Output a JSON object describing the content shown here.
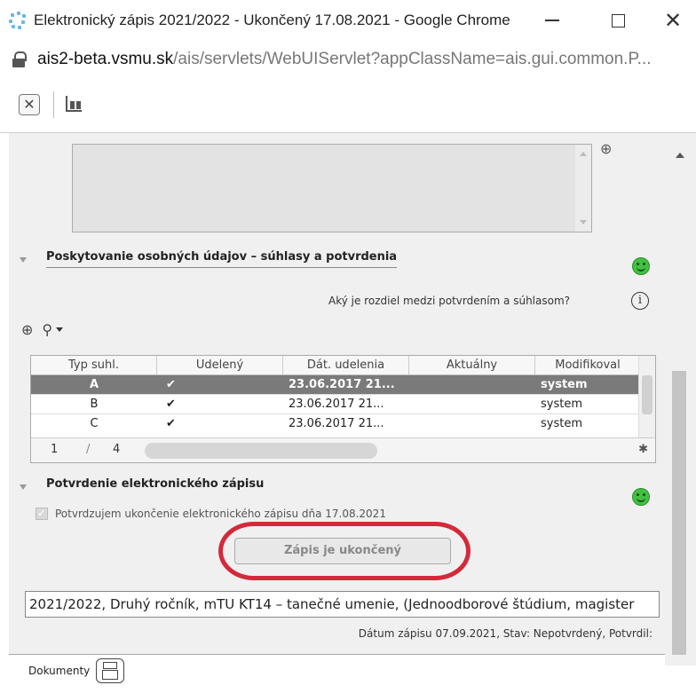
{
  "window": {
    "title": "Elektronický zápis 2021/2022 - Ukončený 17.08.2021 - Google Chrome"
  },
  "address_bar": {
    "host": "ais2-beta.vsmu.sk",
    "path": "/ais/servlets/WebUIServlet?appClassName=ais.gui.common.P..."
  },
  "consent_section": {
    "title": "Poskytovanie osobných údajov – súhlasy a potvrdenia",
    "question_link": "Aký je rozdiel medzi potvrdením a súhlasom?",
    "table": {
      "columns": [
        "Typ suhl.",
        "Udelený",
        "Dát. udelenia",
        "Aktuálny",
        "Modifikoval"
      ],
      "rows": [
        {
          "type": "A",
          "granted": "✔",
          "date": "23.06.2017 21...",
          "current": "",
          "modified_by": "system"
        },
        {
          "type": "B",
          "granted": "✔",
          "date": "23.06.2017 21...",
          "current": "",
          "modified_by": "system"
        },
        {
          "type": "C",
          "granted": "✔",
          "date": "23.06.2017 21...",
          "current": "",
          "modified_by": "system"
        }
      ],
      "page_current": "1",
      "page_sep": "/",
      "page_total": "4"
    }
  },
  "confirmation_section": {
    "title": "Potvrdenie elektronického zápisu",
    "checkbox_label": "Potvrdzujem ukončenie elektronického zápisu dňa 17.08.2021",
    "done_button": "Zápis je ukončený"
  },
  "study_info": "2021/2022, Druhý ročník, mTU KT14 – tanečné umenie, (Jednoodborové štúdium, magister",
  "enrollment_status": "Dátum zápisu 07.09.2021, Stav: Nepotvrdený, Potvrdil:",
  "documents": {
    "label": "Dokumenty"
  },
  "colors": {
    "selected_row": "#7a7a7a",
    "status_ok": "#43c043",
    "highlight_ring": "#d32a3a"
  }
}
